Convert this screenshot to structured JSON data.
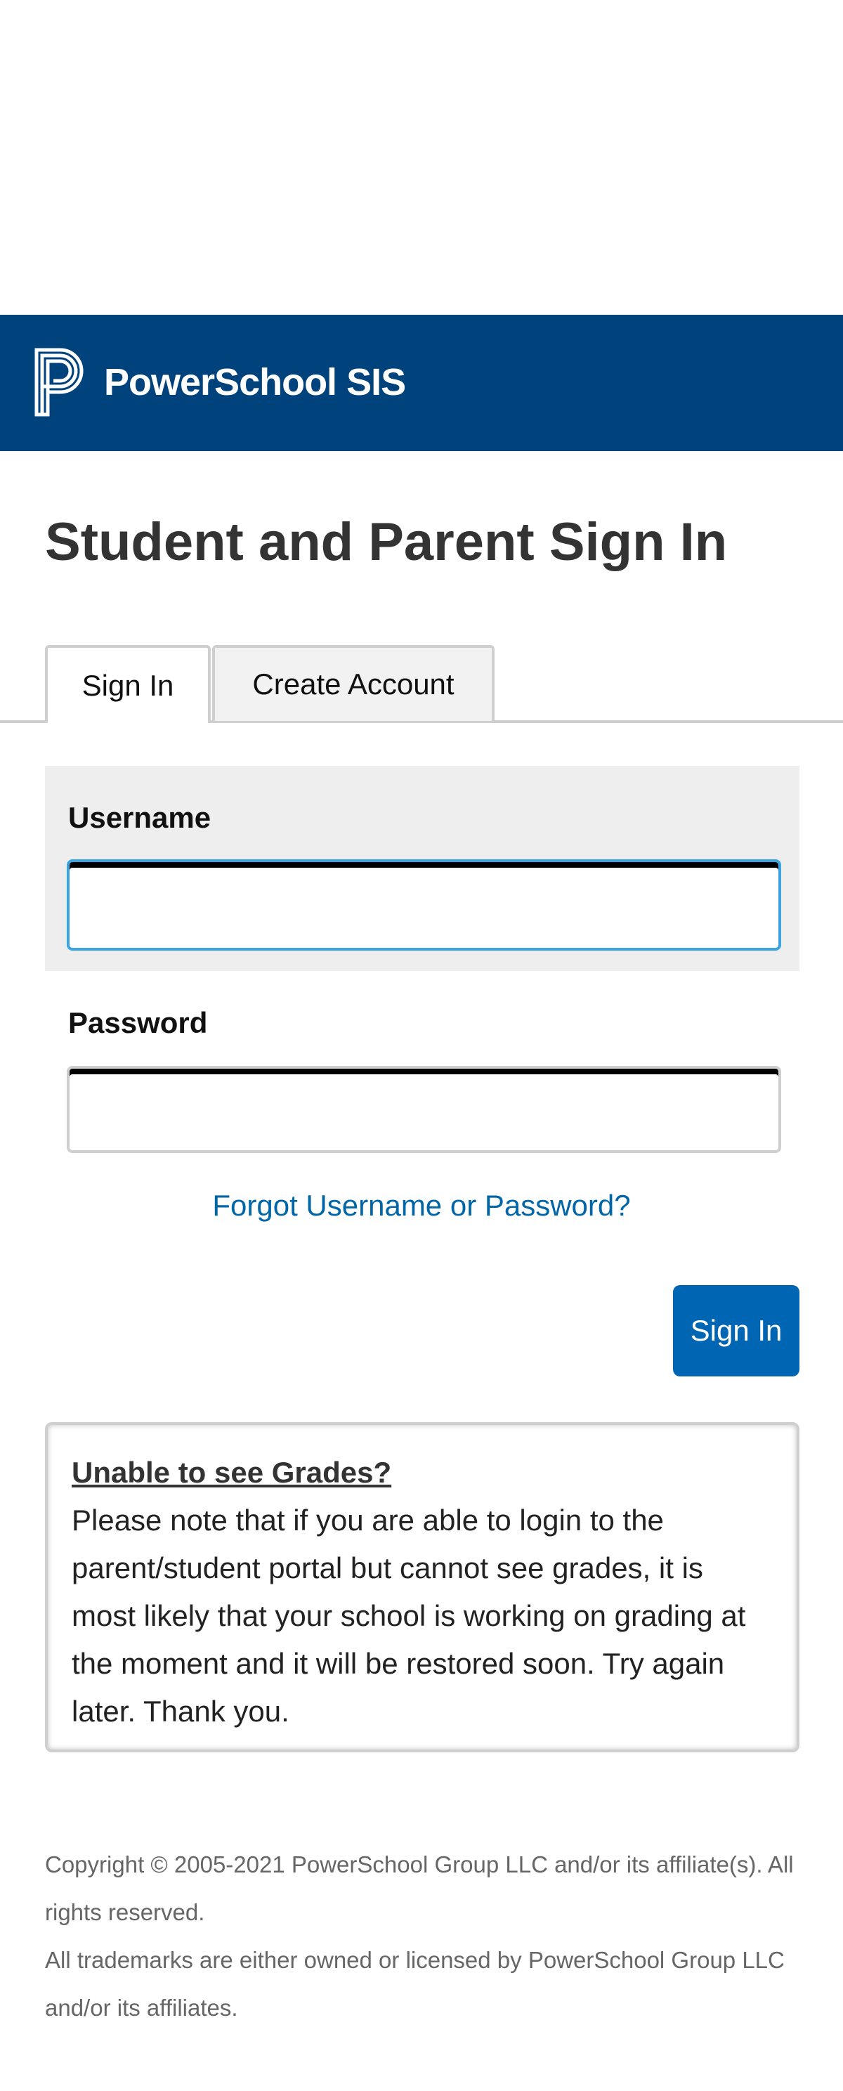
{
  "header": {
    "logo_text": "PowerSchool SIS",
    "logo_icon": "powerschool-p-icon",
    "background_color": "#00427c"
  },
  "page": {
    "title": "Student and Parent Sign In"
  },
  "tabs": [
    {
      "label": "Sign In",
      "active": true
    },
    {
      "label": "Create Account",
      "active": false
    }
  ],
  "form": {
    "username_label": "Username",
    "username_value": "",
    "password_label": "Password",
    "password_value": "",
    "forgot_link": "Forgot Username or Password?",
    "submit_label": "Sign In",
    "accent_color": "#0066b3"
  },
  "notice": {
    "title": "Unable to see Grades?",
    "body": "Please note that if you are able to login to the parent/student portal but cannot see grades, it is most likely that your school is working on grading at the moment and it will be restored soon. Try again later. Thank you."
  },
  "footer": {
    "copyright": "Copyright © 2005-2021 PowerSchool Group LLC and/or its affiliate(s). All rights reserved.",
    "trademark": "All trademarks are either owned or licensed by PowerSchool Group LLC and/or its affiliates."
  }
}
